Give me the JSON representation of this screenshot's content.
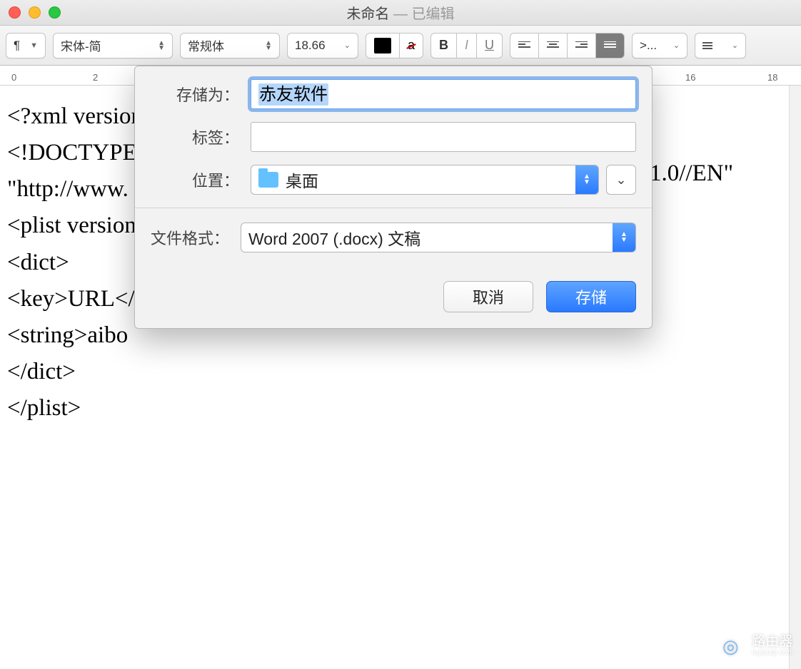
{
  "title": {
    "name": "未命名",
    "state": "已编辑"
  },
  "toolbar": {
    "para_icon": "¶",
    "font_family": "宋体-简",
    "font_style": "常规体",
    "font_size": "18.66",
    "text_color": "#000000",
    "bold": "B",
    "italic": "I",
    "underline": "U",
    "spacing_label": ">...",
    "list_label": "☰"
  },
  "ruler": {
    "marks": [
      "0",
      "2",
      "16",
      "18"
    ]
  },
  "document": {
    "lines": [
      "<?xml version",
      "<!DOCTYPE",
      "\"http://www.",
      "<plist version",
      "<dict>",
      "<key>URL</",
      "<string>aibo",
      "</dict>",
      "</plist>"
    ],
    "right_fragment": "1.0//EN\""
  },
  "dialog": {
    "save_as_label": "存储为：",
    "save_as_value": "赤友软件",
    "tags_label": "标签：",
    "tags_value": "",
    "location_label": "位置：",
    "location_value": "桌面",
    "format_label": "文件格式：",
    "format_value": "Word 2007 (.docx) 文稿",
    "cancel": "取消",
    "save": "存储"
  },
  "watermark": {
    "brand": "路由器",
    "sub": "luyouqi.com"
  }
}
